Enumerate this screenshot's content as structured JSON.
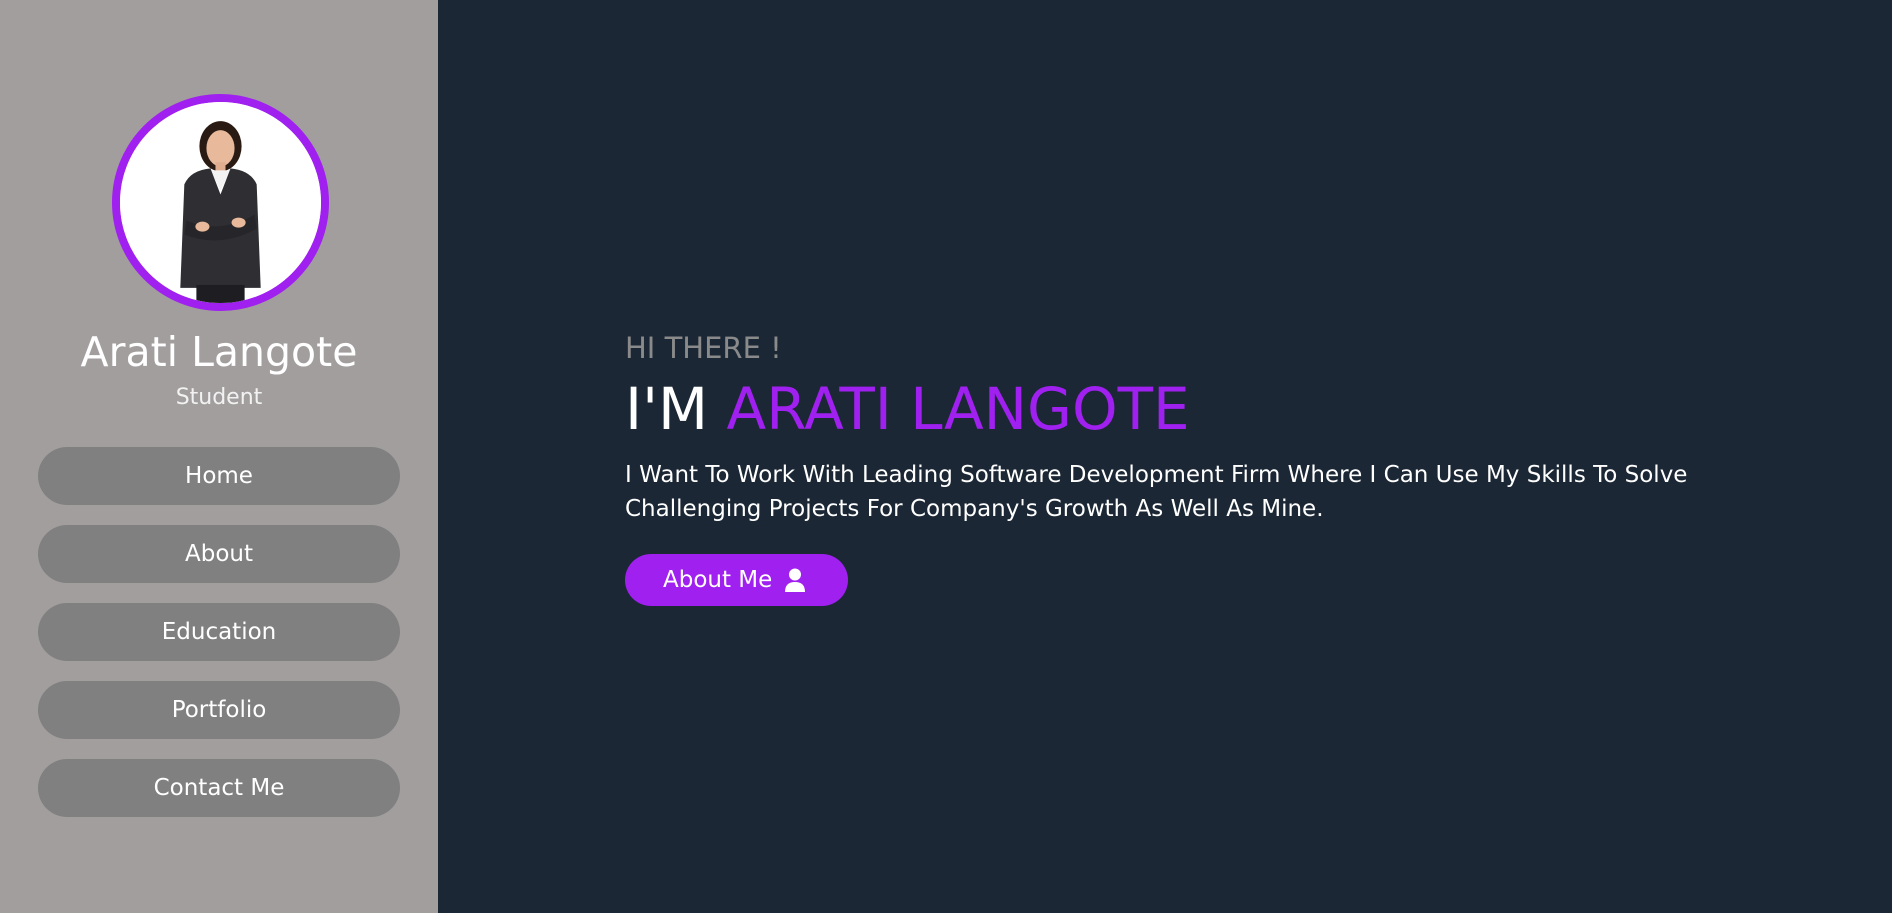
{
  "sidebar": {
    "name": "Arati Langote",
    "role": "Student",
    "nav": [
      {
        "label": "Home"
      },
      {
        "label": "About"
      },
      {
        "label": "Education"
      },
      {
        "label": "Portfolio"
      },
      {
        "label": "Contact Me"
      }
    ]
  },
  "hero": {
    "greeting": "HI THERE !",
    "headline_prefix": "I'M",
    "headline_name": "ARATI LANGOTE",
    "tagline": "I Want To Work With Leading Software Development Firm Where I Can Use My Skills To Solve Challenging Projects For Company's Growth As Well As Mine.",
    "cta_label": "About Me",
    "cta_icon": "user-icon"
  },
  "colors": {
    "accent": "#a020f0",
    "sidebar_bg": "#a29e9e",
    "main_bg": "#1b2735",
    "nav_button_bg": "#808080"
  }
}
